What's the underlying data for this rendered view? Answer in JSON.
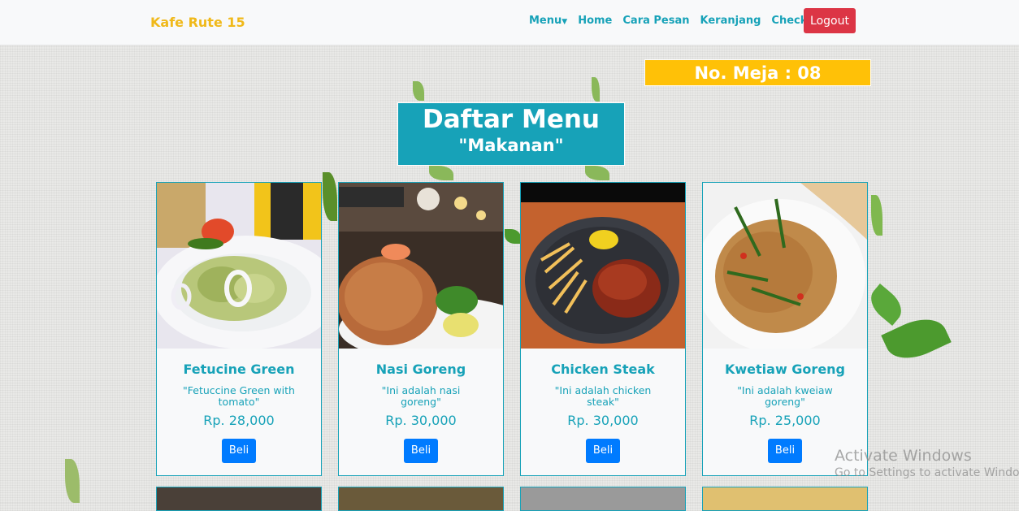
{
  "navbar": {
    "brand": "Kafe Rute 15",
    "menu_label": "Menu",
    "home_label": "Home",
    "cara_pesan_label": "Cara Pesan",
    "keranjang_label": "Keranjang",
    "checkout_label": "Checkout",
    "logout_label": "Logout"
  },
  "meja": {
    "label": "No. Meja : 08"
  },
  "header": {
    "title": "Daftar Menu",
    "subtitle": "\"Makanan\""
  },
  "menu_items": [
    {
      "name": "Fetucine Green",
      "description": "\"Fetuccine Green with tomato\"",
      "price": "Rp. 28,000",
      "button": "Beli"
    },
    {
      "name": "Nasi Goreng",
      "description": "\"Ini adalah nasi goreng\"",
      "price": "Rp. 30,000",
      "button": "Beli"
    },
    {
      "name": "Chicken Steak",
      "description": "\"Ini adalah chicken steak\"",
      "price": "Rp. 30,000",
      "button": "Beli"
    },
    {
      "name": "Kwetiaw Goreng",
      "description": "\"Ini adalah kweiaw goreng\"",
      "price": "Rp. 25,000",
      "button": "Beli"
    }
  ],
  "watermark": {
    "line1": "Activate Windows",
    "line2": "Go to Settings to activate Windows."
  },
  "colors": {
    "accent": "#17a2b8",
    "brand": "#f0b91a",
    "danger": "#dc3545",
    "warning": "#ffc107",
    "primary": "#007bff"
  }
}
